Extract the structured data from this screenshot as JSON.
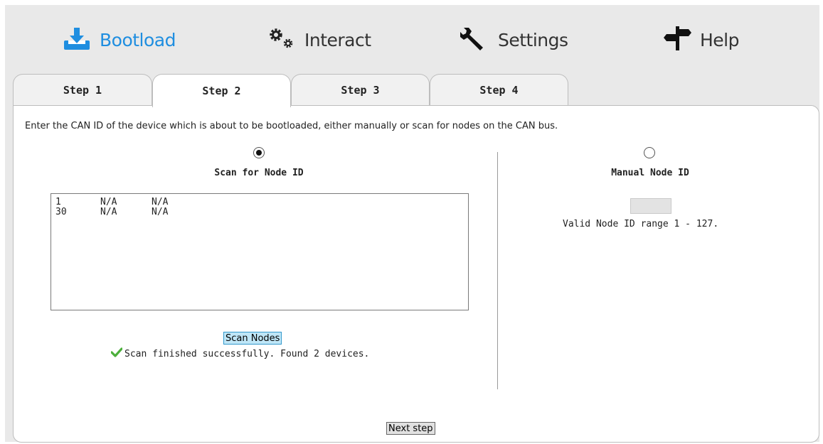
{
  "nav": {
    "items": [
      {
        "label": "Bootload",
        "icon": "download-icon",
        "active": true
      },
      {
        "label": "Interact",
        "icon": "gears-icon",
        "active": false
      },
      {
        "label": "Settings",
        "icon": "wrench-icon",
        "active": false
      },
      {
        "label": "Help",
        "icon": "signpost-icon",
        "active": false
      }
    ],
    "active_color": "#1f8ee0"
  },
  "tabs": [
    {
      "label": "Step 1",
      "active": false
    },
    {
      "label": "Step 2",
      "active": true
    },
    {
      "label": "Step 3",
      "active": false
    },
    {
      "label": "Step 4",
      "active": false
    }
  ],
  "panel": {
    "intro": "Enter the CAN ID of the device which is about to be bootloaded, either manually or scan for nodes on the CAN bus.",
    "scan": {
      "title": "Scan for Node ID",
      "selected": true,
      "nodes": [
        {
          "id": "1",
          "col2": "N/A",
          "col3": "N/A"
        },
        {
          "id": "30",
          "col2": "N/A",
          "col3": "N/A"
        }
      ],
      "button_label": "Scan Nodes",
      "status": "Scan finished successfully. Found 2 devices."
    },
    "manual": {
      "title": "Manual Node ID",
      "selected": false,
      "value": "",
      "hint": "Valid Node ID range 1 - 127."
    },
    "next_label": "Next step"
  }
}
